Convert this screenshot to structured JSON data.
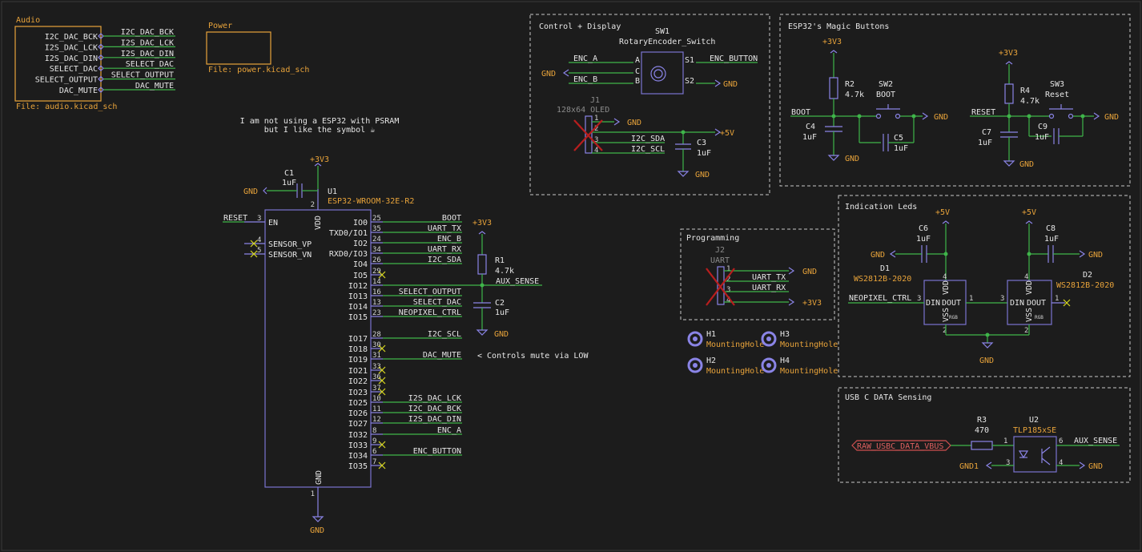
{
  "sheets": {
    "audio": {
      "title": "Audio",
      "file": "File: audio.kicad_sch",
      "pins": [
        "I2C_DAC_BCK",
        "I2S_DAC_LCK",
        "I2S_DAC_DIN",
        "SELECT_DAC",
        "SELECT_OUTPUT",
        "DAC_MUTE"
      ],
      "nets": [
        "I2C_DAC_BCK",
        "I2S_DAC_LCK",
        "I2S_DAC_DIN",
        "SELECT_DAC",
        "SELECT_OUTPUT",
        "DAC_MUTE"
      ]
    },
    "power": {
      "title": "Power",
      "file": "File: power.kicad_sch"
    }
  },
  "notes": {
    "psram_line1": "I am not using a ESP32 with PSRAM",
    "psram_line2": "but I like the symbol ☕",
    "mute_note": "< Controls mute via LOW"
  },
  "mcu": {
    "ref": "U1",
    "value": "ESP32-WROOM-32E-R2",
    "vdd": "VDD",
    "gnd": "GND",
    "left_pins": [
      {
        "num": "3",
        "name": "EN",
        "net": "RESET"
      },
      {
        "num": "4",
        "name": "SENSOR_VP",
        "net": ""
      },
      {
        "num": "5",
        "name": "SENSOR_VN",
        "net": ""
      }
    ],
    "right_pins": [
      {
        "num": "25",
        "name": "IO0",
        "net": "BOOT"
      },
      {
        "num": "35",
        "name": "TXD0/IO1",
        "net": "UART_TX"
      },
      {
        "num": "24",
        "name": "IO2",
        "net": "ENC_B"
      },
      {
        "num": "34",
        "name": "RXD0/IO3",
        "net": "UART_RX"
      },
      {
        "num": "26",
        "name": "IO4",
        "net": "I2C_SDA"
      },
      {
        "num": "29",
        "name": "IO5",
        "net": ""
      },
      {
        "num": "14",
        "name": "IO12",
        "net": ""
      },
      {
        "num": "16",
        "name": "IO13",
        "net": "SELECT_OUTPUT"
      },
      {
        "num": "13",
        "name": "IO14",
        "net": "SELECT_DAC"
      },
      {
        "num": "23",
        "name": "IO15",
        "net": "NEOPIXEL_CTRL"
      },
      {
        "num": "28",
        "name": "IO17",
        "net": "I2C_SCL"
      },
      {
        "num": "30",
        "name": "IO18",
        "net": ""
      },
      {
        "num": "31",
        "name": "IO19",
        "net": "DAC_MUTE"
      },
      {
        "num": "33",
        "name": "IO21",
        "net": ""
      },
      {
        "num": "36",
        "name": "IO22",
        "net": ""
      },
      {
        "num": "37",
        "name": "IO23",
        "net": ""
      },
      {
        "num": "10",
        "name": "IO25",
        "net": "I2S_DAC_LCK"
      },
      {
        "num": "11",
        "name": "IO26",
        "net": "I2C_DAC_BCK"
      },
      {
        "num": "12",
        "name": "IO27",
        "net": "I2S_DAC_DIN"
      },
      {
        "num": "8",
        "name": "IO32",
        "net": "ENC_A"
      },
      {
        "num": "9",
        "name": "IO33",
        "net": ""
      },
      {
        "num": "6",
        "name": "IO34",
        "net": "ENC_BUTTON"
      },
      {
        "num": "7",
        "name": "IO35",
        "net": ""
      }
    ],
    "gnd_pin_num": "1",
    "vdd_pin_num": "2"
  },
  "c1": {
    "ref": "C1",
    "value": "1uF"
  },
  "r1": {
    "ref": "R1",
    "value": "4.7k"
  },
  "c2": {
    "ref": "C2",
    "value": "1uF"
  },
  "aux_sense": "AUX_SENSE",
  "power": {
    "v33": "+3V3",
    "v5": "+5V",
    "gnd": "GND",
    "gnd1": "GND1"
  },
  "control": {
    "title": "Control + Display",
    "sw1_ref": "SW1",
    "sw1_value": "RotaryEncoder_Switch",
    "enc_a": "ENC_A",
    "enc_b": "ENC_B",
    "enc_button": "ENC_BUTTON",
    "pins": [
      "A",
      "C",
      "B",
      "S1",
      "S2"
    ],
    "j1_ref": "J1",
    "j1_value": "128x64 OLED",
    "i2c_sda": "I2C_SDA",
    "i2c_scl": "I2C_SCL",
    "j1_pins": [
      "1",
      "2",
      "3",
      "4"
    ],
    "c3_ref": "C3",
    "c3_value": "1uF"
  },
  "magic": {
    "title": "ESP32's Magic Buttons",
    "boot": "BOOT",
    "reset": "RESET",
    "r2_ref": "R2",
    "r2_value": "4.7k",
    "sw2_ref": "SW2",
    "sw2_value": "BOOT",
    "c4_ref": "C4",
    "c4_value": "1uF",
    "c5_ref": "C5",
    "c5_value": "1uF",
    "r4_ref": "R4",
    "r4_value": "4.7k",
    "sw3_ref": "SW3",
    "sw3_value": "Reset",
    "c7_ref": "C7",
    "c7_value": "1uF",
    "c9_ref": "C9",
    "c9_value": "1uF"
  },
  "programming": {
    "title": "Programming",
    "j2_ref": "J2",
    "j2_value": "UART",
    "uart_tx": "UART_TX",
    "uart_rx": "UART_RX",
    "pins": [
      "1",
      "2",
      "3",
      "4"
    ]
  },
  "holes": [
    {
      "ref": "H1",
      "value": "MountingHole"
    },
    {
      "ref": "H2",
      "value": "MountingHole"
    },
    {
      "ref": "H3",
      "value": "MountingHole"
    },
    {
      "ref": "H4",
      "value": "MountingHole"
    }
  ],
  "leds": {
    "title": "Indication Leds",
    "c6_ref": "C6",
    "c6_value": "1uF",
    "c8_ref": "C8",
    "c8_value": "1uF",
    "d1_ref": "D1",
    "d1_value": "WS2812B-2020",
    "d2_ref": "D2",
    "d2_value": "WS2812B-2020",
    "neopixel": "NEOPIXEL_CTRL",
    "vdd": "VDD",
    "vss": "VSS",
    "din": "DIN",
    "dout": "DOUT",
    "rgb": "RGB",
    "pins": {
      "din": "3",
      "dout": "1",
      "vdd": "4",
      "vss": "2"
    }
  },
  "usb": {
    "title": "USB C DATA Sensing",
    "r3_ref": "R3",
    "r3_value": "470",
    "u2_ref": "U2",
    "u2_value": "TLP185xSE",
    "raw_label": "RAW_USBC_DATA_VBUS",
    "pins": {
      "p1": "1",
      "p3": "3",
      "p4": "4",
      "p6": "6"
    }
  },
  "colors": {
    "background": "#1c1c1c",
    "wire": "#3fb54a",
    "symbol": "#8a84e6",
    "reference": "#e6e6e6",
    "sheet": "#e8a33a",
    "no_connect": "#d8d820",
    "dnp_cross": "#b81e1e"
  }
}
